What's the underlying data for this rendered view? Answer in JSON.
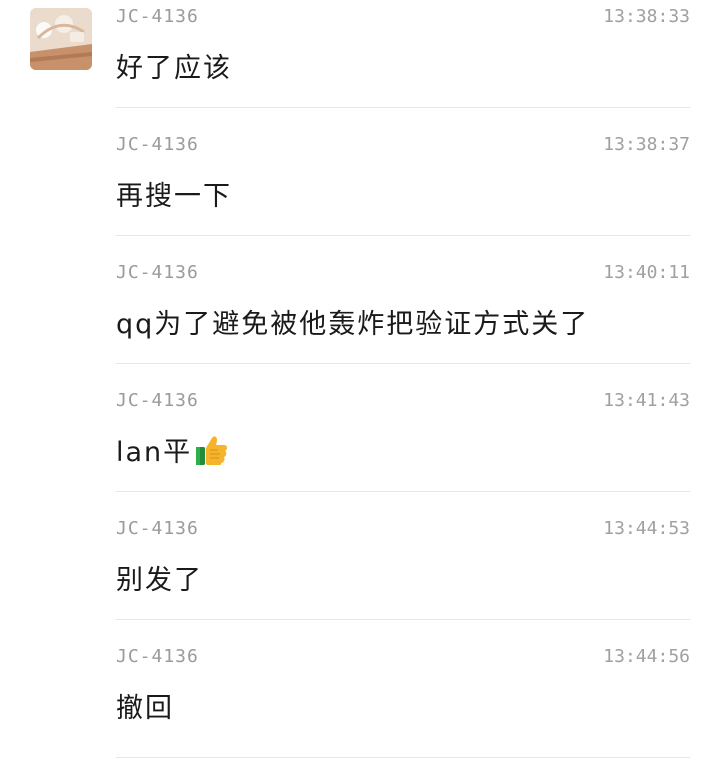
{
  "messages": [
    {
      "sender": "JC-4136",
      "time": "13:38:33",
      "text": "好了应该",
      "show_avatar": true
    },
    {
      "sender": "JC-4136",
      "time": "13:38:37",
      "text": "再搜一下"
    },
    {
      "sender": "JC-4136",
      "time": "13:40:11",
      "text": "qq为了避免被他轰炸把验证方式关了"
    },
    {
      "sender": "JC-4136",
      "time": "13:41:43",
      "text": "lan平",
      "emoji": "thumbs-up-icon"
    },
    {
      "sender": "JC-4136",
      "time": "13:44:53",
      "text": "别发了"
    },
    {
      "sender": "JC-4136",
      "time": "13:44:56",
      "text": "撤回"
    }
  ]
}
